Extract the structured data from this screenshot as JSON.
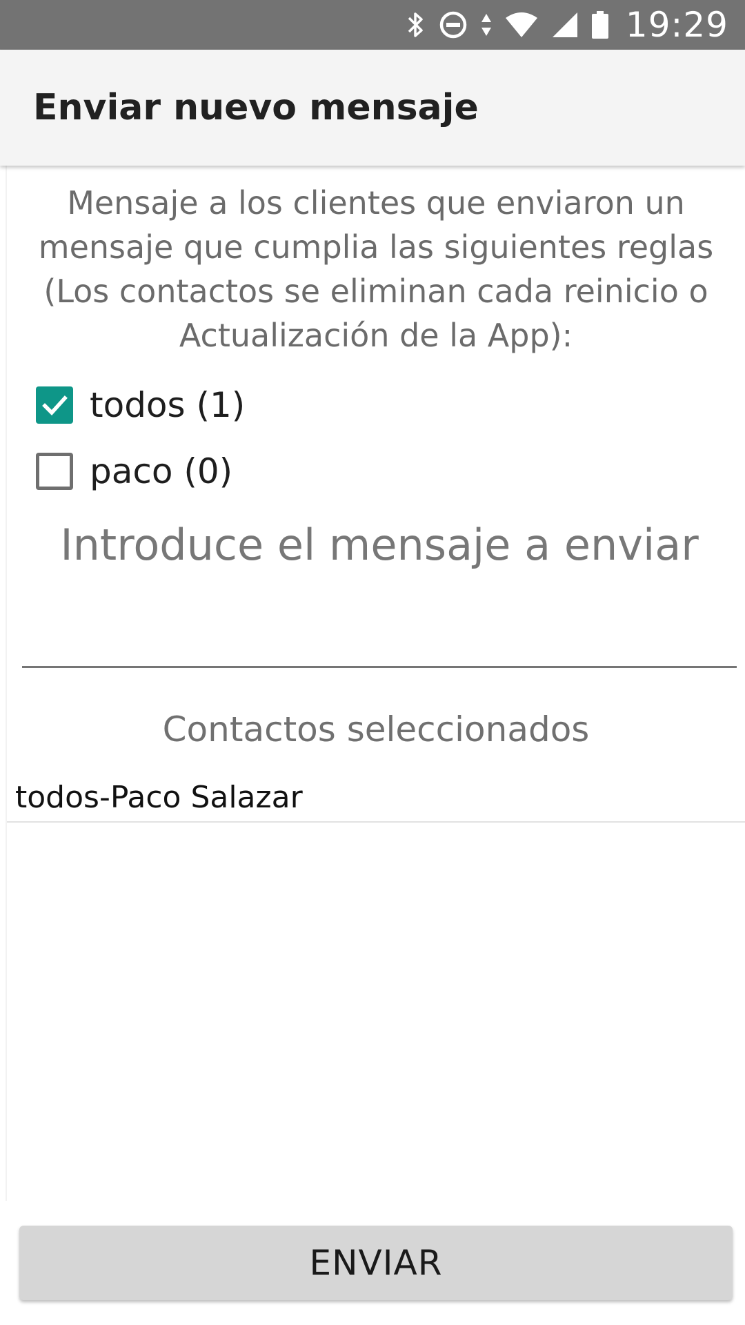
{
  "status_bar": {
    "time": "19:29",
    "icons": [
      "bluetooth-icon",
      "do-not-disturb-icon",
      "data-transfer-icon",
      "wifi-icon",
      "cell-signal-icon",
      "battery-icon"
    ]
  },
  "app_bar": {
    "title": "Enviar nuevo mensaje"
  },
  "intro": {
    "text": "Mensaje a los clientes que enviaron un mensaje que cumplia las siguientes reglas (Los contactos se eliminan cada reinicio o Actualización de la App):"
  },
  "rules": [
    {
      "label": "todos (1)",
      "checked": true
    },
    {
      "label": "paco (0)",
      "checked": false
    }
  ],
  "message_input": {
    "placeholder": "Introduce el mensaje a enviar",
    "value": ""
  },
  "contacts": {
    "heading": "Contactos seleccionados",
    "items": [
      "todos-Paco Salazar"
    ]
  },
  "send_button": {
    "label": "ENVIAR"
  },
  "colors": {
    "status_bar": "#737373",
    "app_bar": "#f4f4f4",
    "accent": "#0e9688",
    "button": "#d6d6d6"
  }
}
